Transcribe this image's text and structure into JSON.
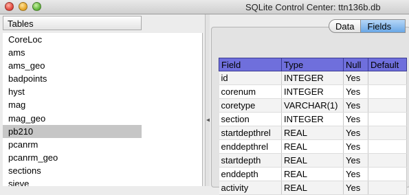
{
  "window": {
    "title": "SQLite Control Center: ttn136b.db"
  },
  "tables_panel": {
    "header": "Tables",
    "items": [
      "CoreLoc",
      "ams",
      "ams_geo",
      "badpoints",
      "hyst",
      "mag",
      "mag_geo",
      "pb210",
      "pcanrm",
      "pcanrm_geo",
      "sections",
      "sieve"
    ],
    "selected": "pb210"
  },
  "tabs": {
    "data_label": "Data",
    "fields_label": "Fields",
    "active": "Fields"
  },
  "fields_table": {
    "columns": [
      "Field",
      "Type",
      "Null",
      "Default"
    ],
    "rows": [
      [
        "id",
        "INTEGER",
        "Yes",
        ""
      ],
      [
        "corenum",
        "INTEGER",
        "Yes",
        ""
      ],
      [
        "coretype",
        "VARCHAR(1)",
        "Yes",
        ""
      ],
      [
        "section",
        "INTEGER",
        "Yes",
        ""
      ],
      [
        "startdepthrel",
        "REAL",
        "Yes",
        ""
      ],
      [
        "enddepthrel",
        "REAL",
        "Yes",
        ""
      ],
      [
        "startdepth",
        "REAL",
        "Yes",
        ""
      ],
      [
        "enddepth",
        "REAL",
        "Yes",
        ""
      ],
      [
        "activity",
        "REAL",
        "Yes",
        ""
      ]
    ]
  },
  "colors": {
    "header_bg": "#6f6fdc",
    "selected_row_bg": "#c6c6c6",
    "active_tab": "#6aa7e6"
  },
  "icons": {
    "splitter": "triangle-left-icon"
  }
}
